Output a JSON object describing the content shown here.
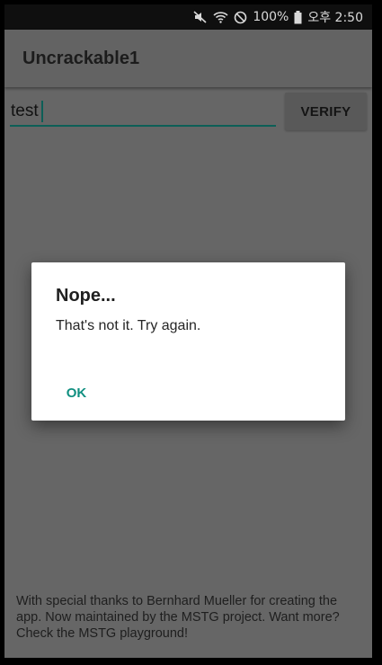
{
  "status_bar": {
    "battery_pct": "100%",
    "clock": "오후 2:50",
    "icons": [
      "mute-icon",
      "wifi-icon",
      "no-signal-icon",
      "battery-icon"
    ]
  },
  "app_bar": {
    "title": "Uncrackable1"
  },
  "input": {
    "value": "test"
  },
  "verify_button": {
    "label": "VERIFY"
  },
  "footer": {
    "text": "With special thanks to Bernhard Mueller for creating the app. Now maintained by the MSTG project. Want more? Check the MSTG playground!"
  },
  "dialog": {
    "title": "Nope...",
    "message": "That's not it. Try again.",
    "ok_label": "OK"
  },
  "colors": {
    "accent": "#108f80",
    "scrim_background": "#666666",
    "dialog_background": "#ffffff"
  }
}
